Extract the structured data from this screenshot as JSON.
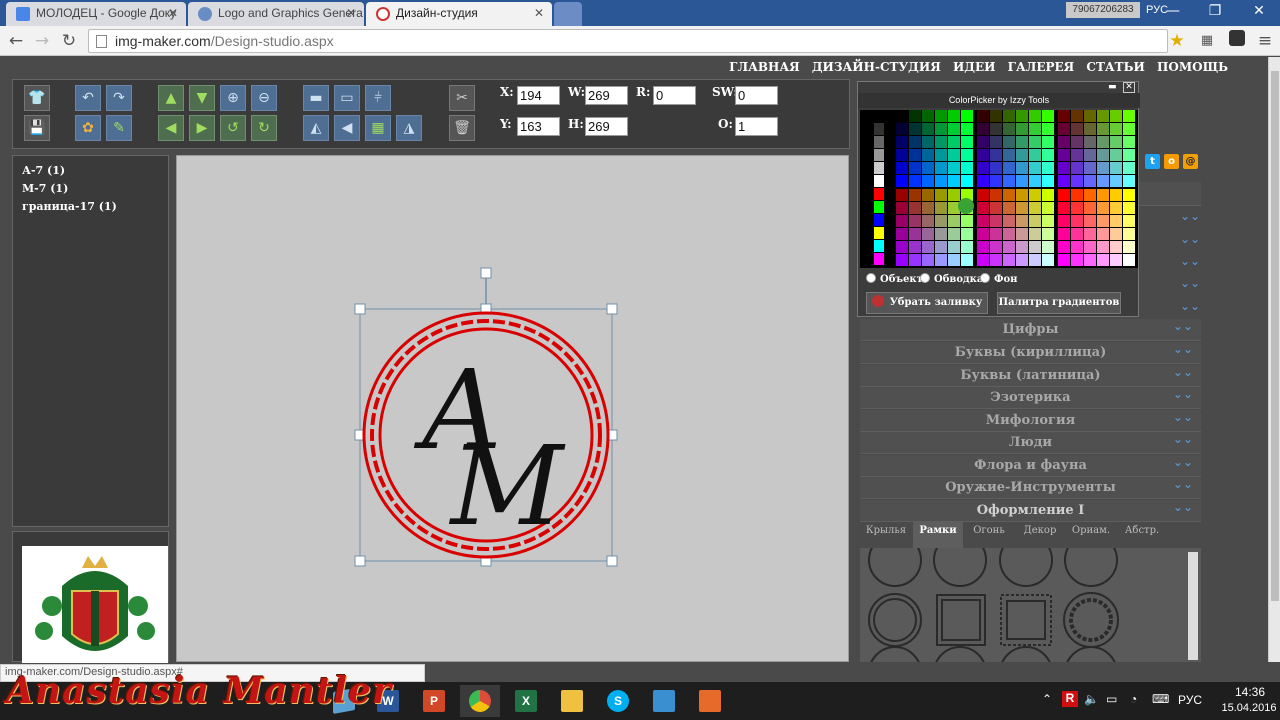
{
  "browser": {
    "tabs": [
      {
        "label": "МОЛОДЕЦ - Google Доку",
        "favicon_color": "#4a86e8"
      },
      {
        "label": "Logo and Graphics Genera",
        "favicon_color": "#6a8cc4"
      },
      {
        "label": "Дизайн-студия",
        "favicon_color": "#cc3333"
      }
    ],
    "phone": "79067206283",
    "lang": "РУС",
    "url_host": "img-maker.com",
    "url_path": "/Design-studio.aspx"
  },
  "topnav": [
    "ГЛАВНАЯ",
    "ДИЗАЙН-СТУДИЯ",
    "ИДЕИ",
    "ГАЛЕРЕЯ",
    "СТАТЬИ",
    "ПОМОЩЬ"
  ],
  "coords": {
    "x_label": "X:",
    "x": "194",
    "y_label": "Y:",
    "y": "163",
    "w_label": "W:",
    "w": "269",
    "h_label": "H:",
    "h": "269",
    "r_label": "R:",
    "r": "0",
    "sw_label": "SW:",
    "sw": "0",
    "o_label": "O:",
    "o": "1"
  },
  "layers": [
    "А-7 (1)",
    "М-7 (1)",
    "граница-17 (1)"
  ],
  "colorpicker": {
    "title": "ColorPicker by Izzy Tools",
    "radio_object": "Объект",
    "radio_stroke": "Обводка",
    "radio_bg": "Фон",
    "remove_fill": "Убрать заливку",
    "gradient_palette": "Палитра градиентов"
  },
  "categories": [
    "Цифры",
    "Буквы (кириллица)",
    "Буквы (латиница)",
    "Эзотерика",
    "Мифология",
    "Люди",
    "Флора и фауна",
    "Оружие-Инструменты",
    "Оформление I"
  ],
  "frame_tabs": [
    "Крылья",
    "Рамки",
    "Огонь",
    "Декор",
    "Ориам.",
    "Абстр."
  ],
  "canvas": {
    "letters": [
      "A",
      "M"
    ],
    "frame_color": "#d90000"
  },
  "status_url": "img-maker.com/Design-studio.aspx#",
  "watermark": "Anastasia Mantler",
  "tray": {
    "time": "14:36",
    "date": "15.04.2016",
    "lang": "РУС"
  },
  "taskbar_apps": [
    {
      "name": "Word",
      "letter": "W",
      "color": "#2b579a"
    },
    {
      "name": "PowerPoint",
      "letter": "P",
      "color": "#d24726"
    },
    {
      "name": "Chrome",
      "letter": "",
      "color": "#dd4b39"
    },
    {
      "name": "Excel",
      "letter": "X",
      "color": "#217346"
    },
    {
      "name": "Explorer",
      "letter": "",
      "color": "#f0c040"
    },
    {
      "name": "Skype",
      "letter": "S",
      "color": "#00aff0"
    },
    {
      "name": "Photos",
      "letter": "",
      "color": "#3a8fd0"
    },
    {
      "name": "Paint",
      "letter": "",
      "color": "#e66b2b"
    }
  ],
  "colors": {
    "accent_blue": "#2b5797",
    "selection_green": "#3aa335"
  }
}
